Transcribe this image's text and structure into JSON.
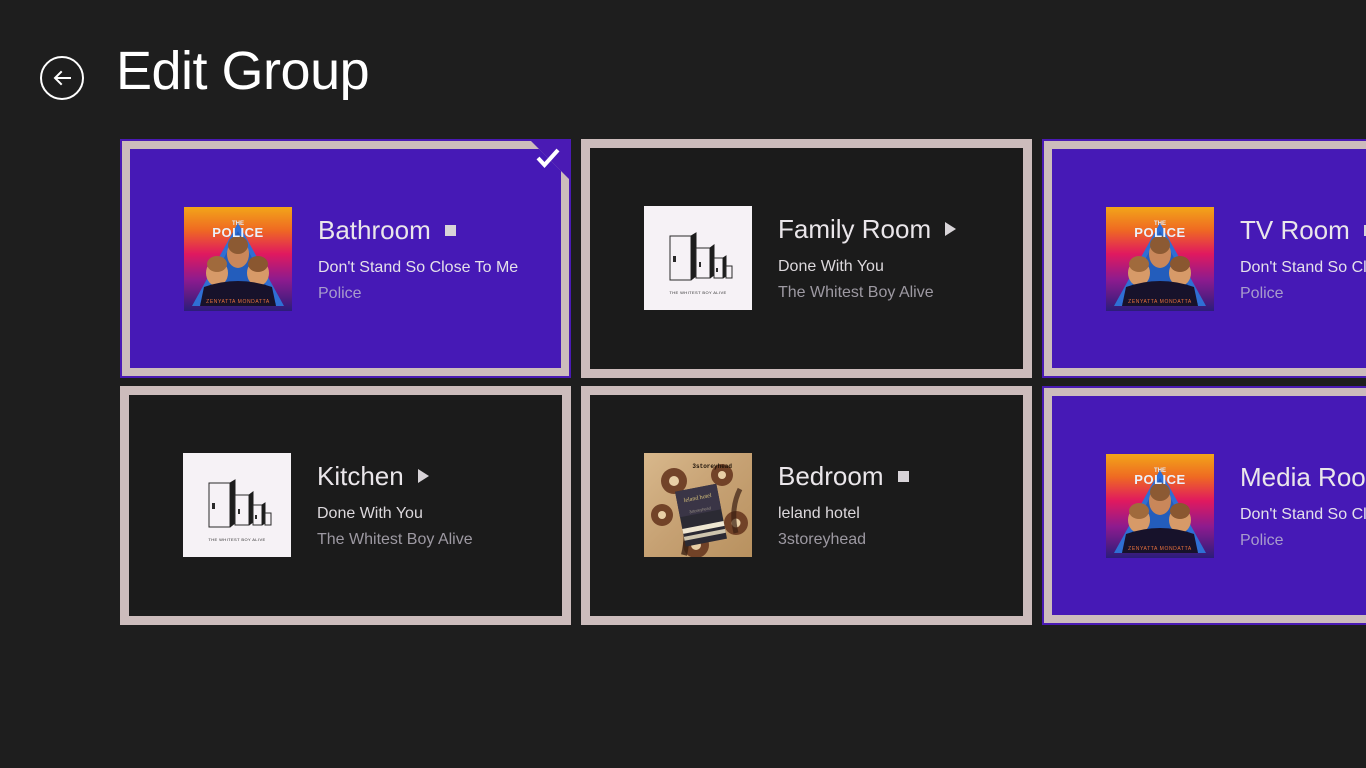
{
  "header": {
    "back_icon": "back-arrow-circle-icon",
    "title": "Edit Group"
  },
  "icons": {
    "stop": "stop-icon",
    "play": "play-icon",
    "check": "check-icon"
  },
  "albums": {
    "police": {
      "name": "police-album-art",
      "title": "The Police - Don't Stand So Close To Me",
      "caption": "THE POLICE"
    },
    "whitest_boy": {
      "name": "whitest-boy-alive-album-art",
      "title": "The Whitest Boy Alive",
      "caption": "THE WHITEST BOY ALIVE"
    },
    "storeyhead": {
      "name": "3storeyhead-album-art",
      "title": "3storeyhead - leland hotel",
      "caption": "3storeyhead"
    }
  },
  "rooms": [
    {
      "name": "Bathroom",
      "track": "Don't Stand So Close To Me",
      "artist": "Police",
      "state": "stop",
      "selected": true,
      "playing": true,
      "art": "police"
    },
    {
      "name": "Family Room",
      "track": "Done With You",
      "artist": "The Whitest Boy Alive",
      "state": "play",
      "selected": false,
      "playing": false,
      "art": "whitest_boy"
    },
    {
      "name": "TV Room",
      "track": "Don't Stand So Close To Me",
      "artist": "Police",
      "state": "stop",
      "selected": false,
      "playing": true,
      "art": "police"
    },
    {
      "name": "Kitchen",
      "track": "Done With You",
      "artist": "The Whitest Boy Alive",
      "state": "play",
      "selected": false,
      "playing": false,
      "art": "whitest_boy"
    },
    {
      "name": "Bedroom",
      "track": "leland hotel",
      "artist": "3storeyhead",
      "state": "stop",
      "selected": false,
      "playing": false,
      "art": "storeyhead"
    },
    {
      "name": "Media Room",
      "track": "Don't Stand So Close To Me",
      "artist": "Police",
      "state": "stop",
      "selected": false,
      "playing": true,
      "art": "police"
    }
  ],
  "colors": {
    "background": "#1e1e1e",
    "tile_background": "#1b1b1b",
    "tile_border": "#ccbcbc",
    "accent_purple": "#4619b6",
    "text_primary": "#eae6ea",
    "text_secondary": "#9d99a2"
  }
}
